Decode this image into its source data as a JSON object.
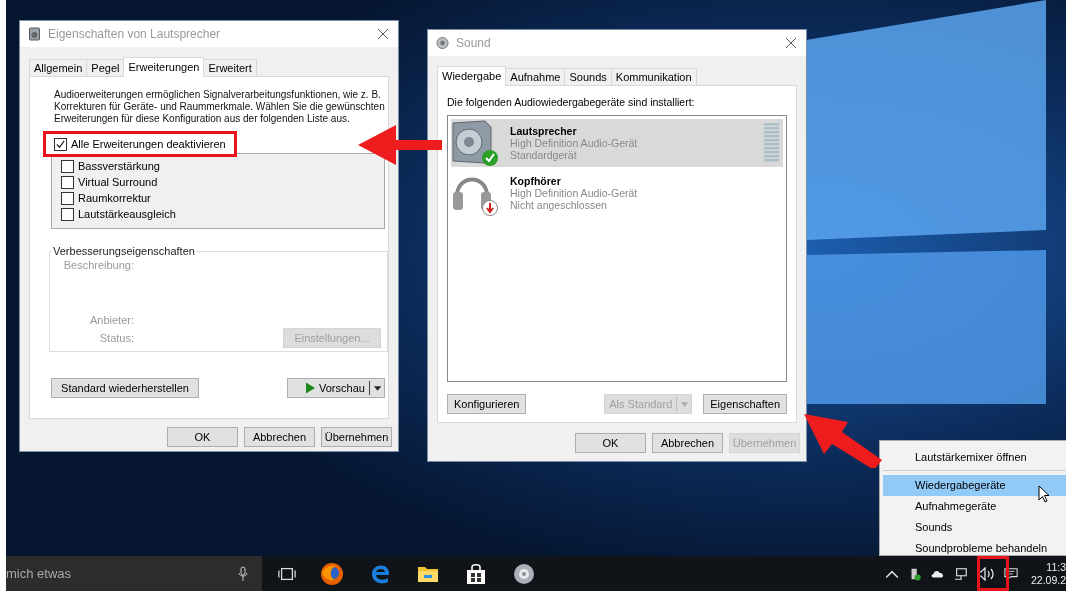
{
  "properties_window": {
    "title": "Eigenschaften von Lautsprecher",
    "tabs": [
      {
        "label": "Allgemein",
        "selected": false
      },
      {
        "label": "Pegel",
        "selected": false
      },
      {
        "label": "Erweiterungen",
        "selected": true
      },
      {
        "label": "Erweitert",
        "selected": false
      }
    ],
    "description": "Audioerweiterungen ermöglichen Signalverarbeitungsfunktionen, wie z. B. Korrekturen für Geräte- und Raummerkmale. Wählen Sie die gewünschten Erweiterungen für diese Konfiguration aus der folgenden Liste aus.",
    "disable_all": {
      "label": "Alle Erweiterungen deaktivieren",
      "checked": true
    },
    "enhancements": [
      {
        "label": "Bassverstärkung",
        "checked": false
      },
      {
        "label": "Virtual Surround",
        "checked": false
      },
      {
        "label": "Raumkorrektur",
        "checked": false
      },
      {
        "label": "Lautstärkeausgleich",
        "checked": false
      }
    ],
    "properties_group": {
      "title": "Verbesserungseigenschaften",
      "description_label": "Beschreibung:",
      "provider_label": "Anbieter:",
      "status_label": "Status:",
      "settings_button": {
        "label": "Einstellungen...",
        "disabled": true
      }
    },
    "restore_button": "Standard wiederherstellen",
    "preview_button": "Vorschau",
    "buttons": [
      {
        "label": "OK",
        "disabled": false
      },
      {
        "label": "Abbrechen",
        "disabled": false
      },
      {
        "label": "Übernehmen",
        "disabled": false
      }
    ]
  },
  "sound_window": {
    "title": "Sound",
    "tabs": [
      {
        "label": "Wiedergabe",
        "selected": true
      },
      {
        "label": "Aufnahme",
        "selected": false
      },
      {
        "label": "Sounds",
        "selected": false
      },
      {
        "label": "Kommunikation",
        "selected": false
      }
    ],
    "heading": "Die folgenden Audiowiedergabegeräte sind installiert:",
    "devices": [
      {
        "kind": "speaker",
        "connected": true,
        "name": "Lautsprecher",
        "driver": "High Definition Audio-Gerät",
        "status": "Standardgerät",
        "selected": true
      },
      {
        "kind": "headphones",
        "connected": false,
        "name": "Kopfhörer",
        "driver": "High Definition Audio-Gerät",
        "status": "Nicht angeschlossen",
        "selected": false
      }
    ],
    "configure_button": {
      "label": "Konfigurieren",
      "disabled": false
    },
    "default_button": {
      "label": "Als Standard",
      "disabled": true
    },
    "properties_button": {
      "label": "Eigenschaften",
      "disabled": false
    },
    "buttons": [
      {
        "label": "OK",
        "disabled": false
      },
      {
        "label": "Abbrechen",
        "disabled": false
      },
      {
        "label": "Übernehmen",
        "disabled": true
      }
    ]
  },
  "context_menu": {
    "items": [
      {
        "label": "Lautstärkemixer öffnen",
        "selected": false
      },
      {
        "label": "Wiedergabegeräte",
        "selected": true
      },
      {
        "label": "Aufnahmegeräte",
        "selected": false
      },
      {
        "label": "Sounds",
        "selected": false
      },
      {
        "label": "Soundprobleme behandeln",
        "selected": false
      }
    ]
  },
  "taskbar": {
    "search_text": "mich etwas",
    "time": "11:3",
    "date": "22.09.2"
  }
}
